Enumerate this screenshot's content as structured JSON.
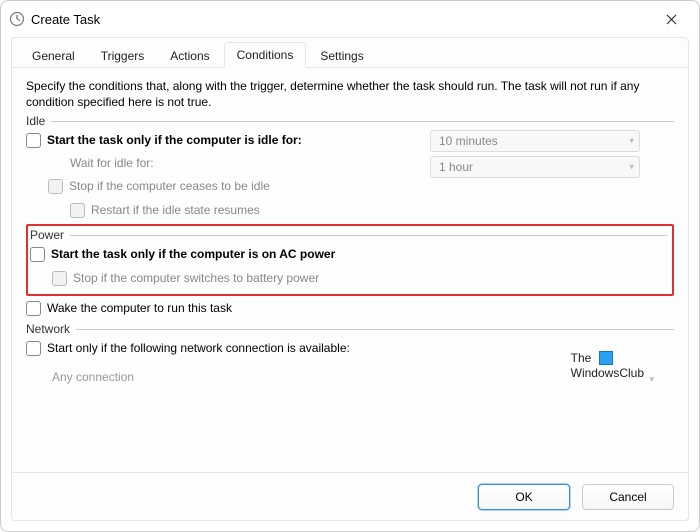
{
  "window": {
    "title": "Create Task"
  },
  "tabs": {
    "general": "General",
    "triggers": "Triggers",
    "actions": "Actions",
    "conditions": "Conditions",
    "settings": "Settings"
  },
  "description": "Specify the conditions that, along with the trigger, determine whether the task should run.  The task will not run  if any condition specified here is not true.",
  "sections": {
    "idle": {
      "label": "Idle",
      "start_only_if_idle": "Start the task only if the computer is idle for:",
      "wait_for_idle": "Wait for idle for:",
      "stop_if_cease_idle": "Stop if the computer ceases to be idle",
      "restart_if_idle_resumes": "Restart if the idle state resumes",
      "idle_duration": "10 minutes",
      "wait_duration": "1 hour"
    },
    "power": {
      "label": "Power",
      "start_only_ac": "Start the task only if the computer is on AC power",
      "stop_on_battery": "Stop if the computer switches to battery power",
      "wake_to_run": "Wake the computer to run this task"
    },
    "network": {
      "label": "Network",
      "start_only_network": "Start only if the following network connection is available:",
      "any_connection": "Any connection"
    }
  },
  "buttons": {
    "ok": "OK",
    "cancel": "Cancel"
  },
  "watermark": {
    "line1": "The",
    "line2": "WindowsClub"
  }
}
